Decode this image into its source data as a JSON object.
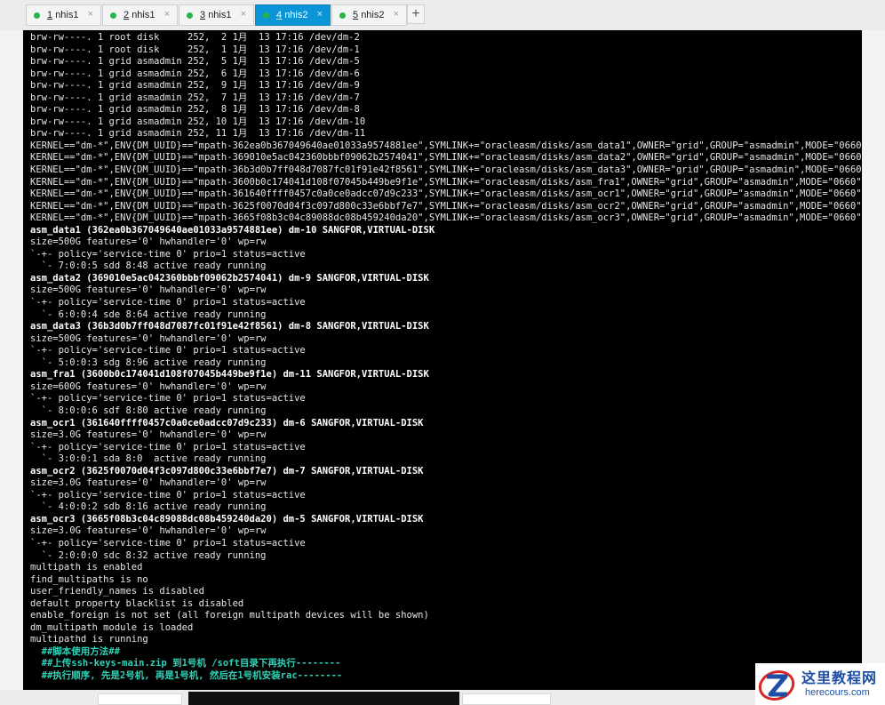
{
  "tabs": [
    {
      "num": "1",
      "name": "nhis1",
      "close": "×"
    },
    {
      "num": "2",
      "name": "nhis1",
      "close": "×"
    },
    {
      "num": "3",
      "name": "nhis1",
      "close": "×"
    },
    {
      "num": "4",
      "name": "nhis2",
      "close": "×",
      "active": true
    },
    {
      "num": "5",
      "name": "nhis2",
      "close": "×"
    }
  ],
  "add_tab": "+",
  "terminal": {
    "lines": [
      "brw-rw----. 1 root disk     252,  2 1月  13 17:16 /dev/dm-2",
      "brw-rw----. 1 root disk     252,  1 1月  13 17:16 /dev/dm-1",
      "brw-rw----. 1 grid asmadmin 252,  5 1月  13 17:16 /dev/dm-5",
      "brw-rw----. 1 grid asmadmin 252,  6 1月  13 17:16 /dev/dm-6",
      "brw-rw----. 1 grid asmadmin 252,  9 1月  13 17:16 /dev/dm-9",
      "brw-rw----. 1 grid asmadmin 252,  7 1月  13 17:16 /dev/dm-7",
      "brw-rw----. 1 grid asmadmin 252,  8 1月  13 17:16 /dev/dm-8",
      "brw-rw----. 1 grid asmadmin 252, 10 1月  13 17:16 /dev/dm-10",
      "brw-rw----. 1 grid asmadmin 252, 11 1月  13 17:16 /dev/dm-11",
      "KERNEL==\"dm-*\",ENV{DM_UUID}==\"mpath-362ea0b367049640ae01033a9574881ee\",SYMLINK+=\"oracleasm/disks/asm_data1\",OWNER=\"grid\",GROUP=\"asmadmin\",MODE=\"0660\"",
      "KERNEL==\"dm-*\",ENV{DM_UUID}==\"mpath-369010e5ac042360bbbf09062b2574041\",SYMLINK+=\"oracleasm/disks/asm_data2\",OWNER=\"grid\",GROUP=\"asmadmin\",MODE=\"0660\"",
      "KERNEL==\"dm-*\",ENV{DM_UUID}==\"mpath-36b3d0b7ff048d7087fc01f91e42f8561\",SYMLINK+=\"oracleasm/disks/asm_data3\",OWNER=\"grid\",GROUP=\"asmadmin\",MODE=\"0660\"",
      "KERNEL==\"dm-*\",ENV{DM_UUID}==\"mpath-3600b0c174041d108f07045b449be9f1e\",SYMLINK+=\"oracleasm/disks/asm_fra1\",OWNER=\"grid\",GROUP=\"asmadmin\",MODE=\"0660\"",
      "KERNEL==\"dm-*\",ENV{DM_UUID}==\"mpath-361640ffff0457c0a0ce0adcc07d9c233\",SYMLINK+=\"oracleasm/disks/asm_ocr1\",OWNER=\"grid\",GROUP=\"asmadmin\",MODE=\"0660\"",
      "KERNEL==\"dm-*\",ENV{DM_UUID}==\"mpath-3625f0070d04f3c097d800c33e6bbf7e7\",SYMLINK+=\"oracleasm/disks/asm_ocr2\",OWNER=\"grid\",GROUP=\"asmadmin\",MODE=\"0660\"",
      "KERNEL==\"dm-*\",ENV{DM_UUID}==\"mpath-3665f08b3c04c89088dc08b459240da20\",SYMLINK+=\"oracleasm/disks/asm_ocr3\",OWNER=\"grid\",GROUP=\"asmadmin\",MODE=\"0660\"",
      "asm_data1 (362ea0b367049640ae01033a9574881ee) dm-10 SANGFOR,VIRTUAL-DISK",
      "size=500G features='0' hwhandler='0' wp=rw",
      "`-+- policy='service-time 0' prio=1 status=active",
      "  `- 7:0:0:5 sdd 8:48 active ready running",
      "asm_data2 (369010e5ac042360bbbf09062b2574041) dm-9 SANGFOR,VIRTUAL-DISK",
      "size=500G features='0' hwhandler='0' wp=rw",
      "`-+- policy='service-time 0' prio=1 status=active",
      "  `- 6:0:0:4 sde 8:64 active ready running",
      "asm_data3 (36b3d0b7ff048d7087fc01f91e42f8561) dm-8 SANGFOR,VIRTUAL-DISK",
      "size=500G features='0' hwhandler='0' wp=rw",
      "`-+- policy='service-time 0' prio=1 status=active",
      "  `- 5:0:0:3 sdg 8:96 active ready running",
      "asm_fra1 (3600b0c174041d108f07045b449be9f1e) dm-11 SANGFOR,VIRTUAL-DISK",
      "size=600G features='0' hwhandler='0' wp=rw",
      "`-+- policy='service-time 0' prio=1 status=active",
      "  `- 8:0:0:6 sdf 8:80 active ready running",
      "asm_ocr1 (361640ffff0457c0a0ce0adcc07d9c233) dm-6 SANGFOR,VIRTUAL-DISK",
      "size=3.0G features='0' hwhandler='0' wp=rw",
      "`-+- policy='service-time 0' prio=1 status=active",
      "  `- 3:0:0:1 sda 8:0  active ready running",
      "asm_ocr2 (3625f0070d04f3c097d800c33e6bbf7e7) dm-7 SANGFOR,VIRTUAL-DISK",
      "size=3.0G features='0' hwhandler='0' wp=rw",
      "`-+- policy='service-time 0' prio=1 status=active",
      "  `- 4:0:0:2 sdb 8:16 active ready running",
      "asm_ocr3 (3665f08b3c04c89088dc08b459240da20) dm-5 SANGFOR,VIRTUAL-DISK",
      "size=3.0G features='0' hwhandler='0' wp=rw",
      "`-+- policy='service-time 0' prio=1 status=active",
      "  `- 2:0:0:0 sdc 8:32 active ready running",
      "multipath is enabled",
      "find_multipaths is no",
      "user_friendly_names is disabled",
      "default property blacklist is disabled",
      "enable_foreign is not set (all foreign multipath devices will be shown)",
      "dm_multipath module is loaded",
      "multipathd is running",
      "  ##脚本使用方法##",
      "  ##上传ssh-keys-main.zip 到1号机 /soft目录下再执行--------",
      "  ##执行顺序, 先是2号机, 再是1号机, 然后在1号机安装rac--------"
    ]
  },
  "watermark": {
    "title": "这里教程网",
    "url": "herecours.com"
  },
  "colors": {
    "tab_active": "#0c95d6",
    "status_dot": "#2bb24c",
    "terminal_bg": "#000000",
    "comment": "#2fd2b8",
    "watermark": "#1e4fa5"
  }
}
